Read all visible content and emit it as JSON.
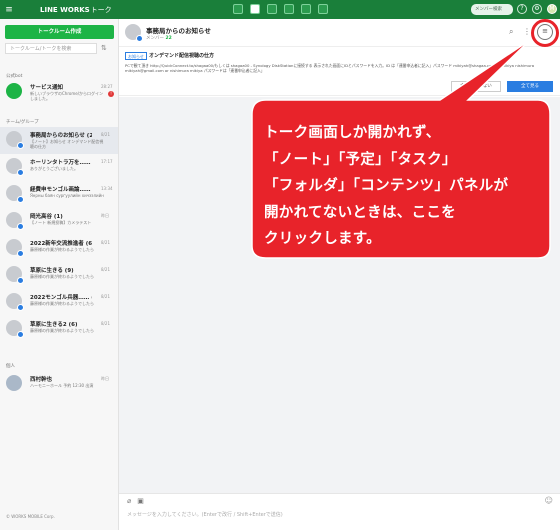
{
  "topbar": {
    "brand": "LINE WORKS",
    "section": "トーク",
    "search_placeholder": "メンバー検索",
    "avatar_initial": "M"
  },
  "sidebar": {
    "create_button": "トークルーム作成",
    "search_placeholder": "トークルーム/トークを検索",
    "section_official": "公式bot",
    "section_group": "チーム/グループ",
    "section_personal": "個人",
    "official_items": [
      {
        "name": "サービス通知",
        "time": "28:27",
        "preview": "新しいブラウザのChrome/からログインしました。",
        "unread": "!"
      }
    ],
    "group_items": [
      {
        "name": "事務局からのお知らせ (22)",
        "time": "8/21",
        "preview": "【ノート】お知らせ オンデマンド配信視聴の仕方"
      },
      {
        "name": "ホーリンタトラ万を…… (2)",
        "time": "17:17",
        "preview": "ありがとうございました。"
      },
      {
        "name": "経費申モンゴル画論…… (3)",
        "time": "13:34",
        "preview": "Янрны баян сургуулийн хичээлийн"
      },
      {
        "name": "岡光高谷 (1)",
        "time": "昨日",
        "preview": "【ノート 新規投稿】カメラテスト"
      },
      {
        "name": "2022新年交流推進者 (6)",
        "time": "8/21",
        "preview": "藤原様の作業が終わるようでしたら"
      },
      {
        "name": "草原に生きる (9)",
        "time": "8/21",
        "preview": "藤原様の作業が終わるようでしたら"
      },
      {
        "name": "2022モンゴル兵器…… (12)",
        "time": "8/21",
        "preview": "藤原様の作業が終わるようでしたら"
      },
      {
        "name": "草原に生きる2 (6)",
        "time": "8/21",
        "preview": "藤原様の作業が終わるようでしたら"
      }
    ],
    "personal_items": [
      {
        "name": "西村幹也",
        "time": "昨日",
        "preview": "ハーモニーホール 予約 12:30 出演"
      }
    ],
    "copyright": "© WORKS MOBILE Corp."
  },
  "room": {
    "title": "事務局からのお知らせ",
    "members_label": "メンバー",
    "members_count": "22",
    "notice_tag": "お知らせ",
    "notice_title": "オンデマンド配信視聴の仕方",
    "notice_body": "PCで観て頂き http://QuickConnect.to/shagaa00/もしくは shagaa00 - Synology DiskStationに接続する 表示された画面にIDとパスワードを入力。ID は「連番申込者に記入」パスワード mikiyah@shagaa.com or mikiya nishimura mikiyah@gmail.com or nishimura mikiya パスワードは「連番申込者に記入」",
    "notice_hide": "今後表示しない",
    "notice_more": "全て見る",
    "day_label": "",
    "composer_placeholder": "メッセージを入力してください。(Enterで改行 / Shift+Enterで送信)"
  },
  "callout": {
    "lines": [
      "トーク画面しか開かれず、",
      "「ノート」「予定」「タスク」",
      "「フォルダ」「コンテンツ」パネルが",
      "開かれてないときは、ここを",
      "クリックします。"
    ]
  },
  "colors": {
    "header_green": "#1a7f3a",
    "button_green": "#1db446",
    "callout_red": "#e8232a",
    "accent_blue": "#2a7de1"
  }
}
